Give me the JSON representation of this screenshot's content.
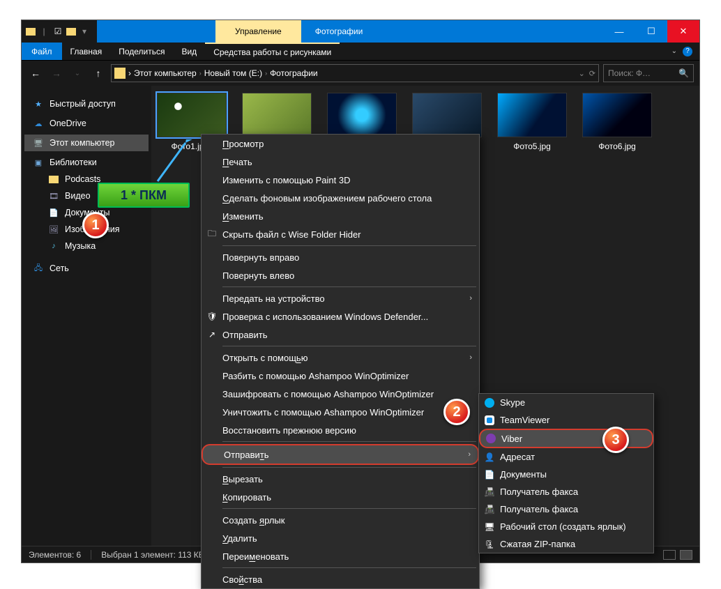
{
  "titlebar": {
    "tool_tab": "Управление",
    "folder_name": "Фотографии"
  },
  "window_controls": {
    "min": "—",
    "max": "☐",
    "close": "✕"
  },
  "menubar": {
    "file": "Файл",
    "items": [
      "Главная",
      "Поделиться",
      "Вид"
    ],
    "tool_tab": "Средства работы с рисунками"
  },
  "nav": {
    "crumbs": [
      "Этот компьютер",
      "Новый том (E:)",
      "Фотографии"
    ],
    "search_placeholder": "Поиск: Ф…"
  },
  "sidebar": {
    "quick": "Быстрый доступ",
    "onedrive": "OneDrive",
    "this_pc": "Этот компьютер",
    "libraries": "Библиотеки",
    "lib_items": [
      "Podcasts",
      "Видео",
      "Документы",
      "Изображения",
      "Музыка"
    ],
    "network": "Сеть"
  },
  "files": [
    {
      "name": "Фото1.jp…",
      "selected": true,
      "cls": "p1"
    },
    {
      "name": "",
      "cls": "p2"
    },
    {
      "name": "",
      "cls": "p3"
    },
    {
      "name": "",
      "cls": "p4"
    },
    {
      "name": "Фото5.jpg",
      "cls": "p5"
    },
    {
      "name": "Фото6.jpg",
      "cls": "p6"
    }
  ],
  "ctx": {
    "view": "Просмотр",
    "print": "Печать",
    "edit_paint3d": "Изменить с помощью Paint 3D",
    "set_wallpaper": "Сделать фоновым изображением рабочего стола",
    "edit": "Изменить",
    "hide_wise": "Скрыть файл с Wise Folder Hider",
    "rotate_r": "Повернуть вправо",
    "rotate_l": "Повернуть влево",
    "cast": "Передать на устройство",
    "defender": "Проверка с использованием Windows Defender...",
    "share": "Отправить",
    "open_with": "Открыть с помощью",
    "ashampoo_split": "Разбить с помощью Ashampoo WinOptimizer",
    "ashampoo_encrypt": "Зашифровать с помощью Ashampoo WinOptimizer",
    "ashampoo_destroy": "Уничтожить с помощью Ashampoo WinOptimizer",
    "restore_ver": "Восстановить прежнюю версию",
    "send_to": "Отправить",
    "cut": "Вырезать",
    "copy": "Копировать",
    "shortcut": "Создать ярлык",
    "delete": "Удалить",
    "rename": "Переименовать",
    "properties": "Свойства"
  },
  "submenu": {
    "skype": "Skype",
    "teamviewer": "TeamViewer",
    "viber": "Viber",
    "recipient": "Адресат",
    "documents": "Документы",
    "fax1": "Получатель факса",
    "fax2": "Получатель факса",
    "desktop": "Рабочий стол (создать ярлык)",
    "zip": "Сжатая ZIP-папка"
  },
  "status": {
    "count": "Элементов: 6",
    "selection": "Выбран 1 элемент: 113 КБ"
  },
  "annotations": {
    "callout": "1 * ПКМ",
    "b1": "1",
    "b2": "2",
    "b3": "3"
  }
}
